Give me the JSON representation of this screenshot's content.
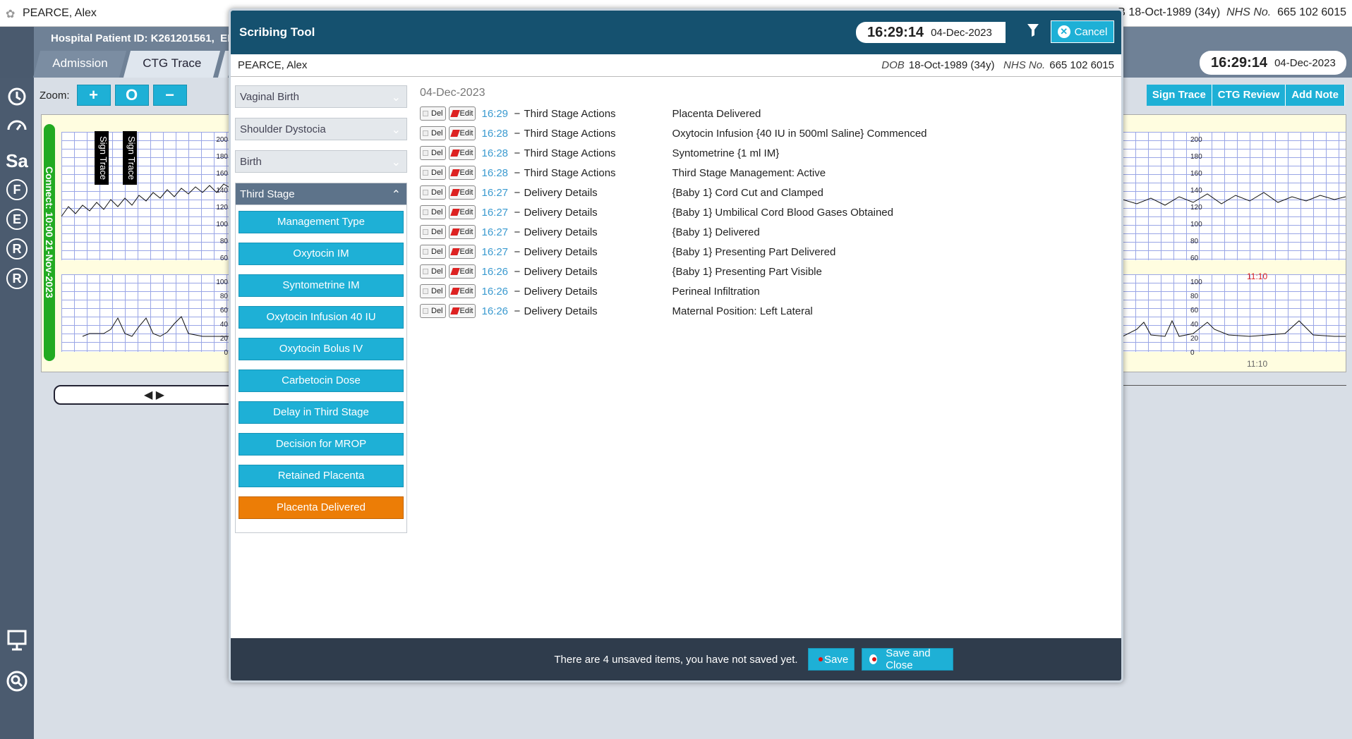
{
  "topbar": {
    "patient_name": "PEARCE, Alex",
    "right_info_prefix": "B",
    "dob": "18-Oct-1989 (34y)",
    "nhs_label": "NHS No.",
    "nhs_value": "665 102 6015"
  },
  "header": {
    "hospital_id": "Hospital Patient ID: K261201561,",
    "edd_prefix": "EDD",
    "tabs": [
      "Admission",
      "CTG Trace"
    ],
    "time": "16:29:14",
    "date": "04-Dec-2023"
  },
  "sidebar": {
    "icons": [
      "alarm-clock-icon",
      "gauge-icon",
      "Sa",
      "F",
      "E",
      "R",
      "R",
      "monitor-icon",
      "search-icon"
    ]
  },
  "ctg": {
    "zoom_label": "Zoom:",
    "zoom_buttons": [
      "+",
      "O",
      "−"
    ],
    "right_buttons": [
      "Sign Trace",
      "CTG Review",
      "Add Note"
    ],
    "connect_label": "Connect: 10:00 21-Nov-2023",
    "sign_tags": [
      "Sign Trace",
      "Sign Trace"
    ],
    "fhr_ticks": [
      "200",
      "180",
      "160",
      "140",
      "120",
      "100",
      "80",
      "60"
    ],
    "toco_ticks": [
      "100",
      "80",
      "60",
      "40",
      "20",
      "0"
    ],
    "time_marker": "11:10",
    "time_marker_bottom": "11:10",
    "scroll_arrows": "◀ ▶"
  },
  "modal": {
    "title": "Scribing Tool",
    "time": "16:29:14",
    "date": "04-Dec-2023",
    "cancel_label": "Cancel",
    "patient_name": "PEARCE, Alex",
    "dob_label": "DOB",
    "dob": "18-Oct-1989 (34y)",
    "nhs_label": "NHS No.",
    "nhs_value": "665 102 6015",
    "categories_collapsed": [
      "Vaginal Birth",
      "Shoulder Dystocia",
      "Birth"
    ],
    "open_category": "Third Stage",
    "action_buttons": [
      "Management Type",
      "Oxytocin IM",
      "Syntometrine IM",
      "Oxytocin Infusion 40 IU",
      "Oxytocin Bolus IV",
      "Carbetocin Dose",
      "Delay in Third Stage",
      "Decision for MROP",
      "Retained Placenta",
      "Placenta Delivered"
    ],
    "highlight_color": "#ec7d06",
    "entries_date": "04-Dec-2023",
    "del_label": "Del",
    "edit_label": "Edit",
    "entries": [
      {
        "time": "16:29",
        "category": "Third Stage Actions",
        "text": "Placenta Delivered"
      },
      {
        "time": "16:28",
        "category": "Third Stage Actions",
        "text": "Oxytocin Infusion {40 IU in 500ml Saline} Commenced"
      },
      {
        "time": "16:28",
        "category": "Third Stage Actions",
        "text": "Syntometrine {1 ml IM}"
      },
      {
        "time": "16:28",
        "category": "Third Stage Actions",
        "text": "Third Stage Management: Active"
      },
      {
        "time": "16:27",
        "category": "Delivery Details",
        "text": "{Baby 1} Cord Cut and Clamped"
      },
      {
        "time": "16:27",
        "category": "Delivery Details",
        "text": "{Baby 1} Umbilical Cord Blood Gases Obtained"
      },
      {
        "time": "16:27",
        "category": "Delivery Details",
        "text": "{Baby 1} Delivered"
      },
      {
        "time": "16:27",
        "category": "Delivery Details",
        "text": "{Baby 1} Presenting Part Delivered"
      },
      {
        "time": "16:26",
        "category": "Delivery Details",
        "text": "{Baby 1} Presenting Part Visible"
      },
      {
        "time": "16:26",
        "category": "Delivery Details",
        "text": "Perineal Infiltration"
      },
      {
        "time": "16:26",
        "category": "Delivery Details",
        "text": "Maternal Position: Left Lateral"
      }
    ],
    "footer_message": "There are 4 unsaved items, you have not saved yet.",
    "save_label": "Save",
    "save_close_label": "Save and Close"
  }
}
